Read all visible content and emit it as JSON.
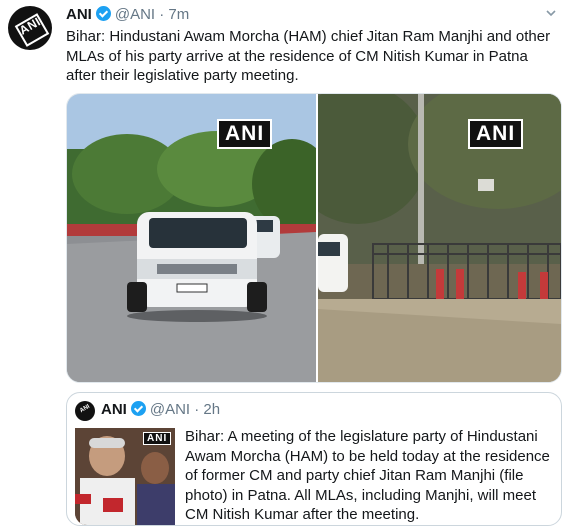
{
  "tweet": {
    "name": "ANI",
    "handle": "@ANI",
    "separator": "·",
    "time": "7m",
    "text": "Bihar: Hindustani Awam Morcha (HAM) chief Jitan Ram Manjhi and other MLAs of his party arrive at the residence of CM Nitish Kumar in Patna after their legislative party meeting.",
    "avatar_logo": "ANI",
    "media": {
      "left_watermark": "ANI",
      "right_watermark": "ANI"
    }
  },
  "quoted": {
    "name": "ANI",
    "handle": "@ANI",
    "separator": "·",
    "time": "2h",
    "avatar_logo": "ANI",
    "thumb_watermark": "ANI",
    "text": "Bihar: A meeting of the legislature party of Hindustani Awam Morcha (HAM) to be held today at the residence of former CM and party chief Jitan Ram Manjhi (file photo) in Patna. All MLAs, including Manjhi, will meet CM Nitish Kumar after the meeting."
  },
  "icons": {
    "verified": "verified-badge-icon",
    "more": "chevron-down-icon"
  },
  "colors": {
    "verified": "#1da1f2",
    "muted_text": "#657786",
    "border": "#ccd6dd"
  }
}
